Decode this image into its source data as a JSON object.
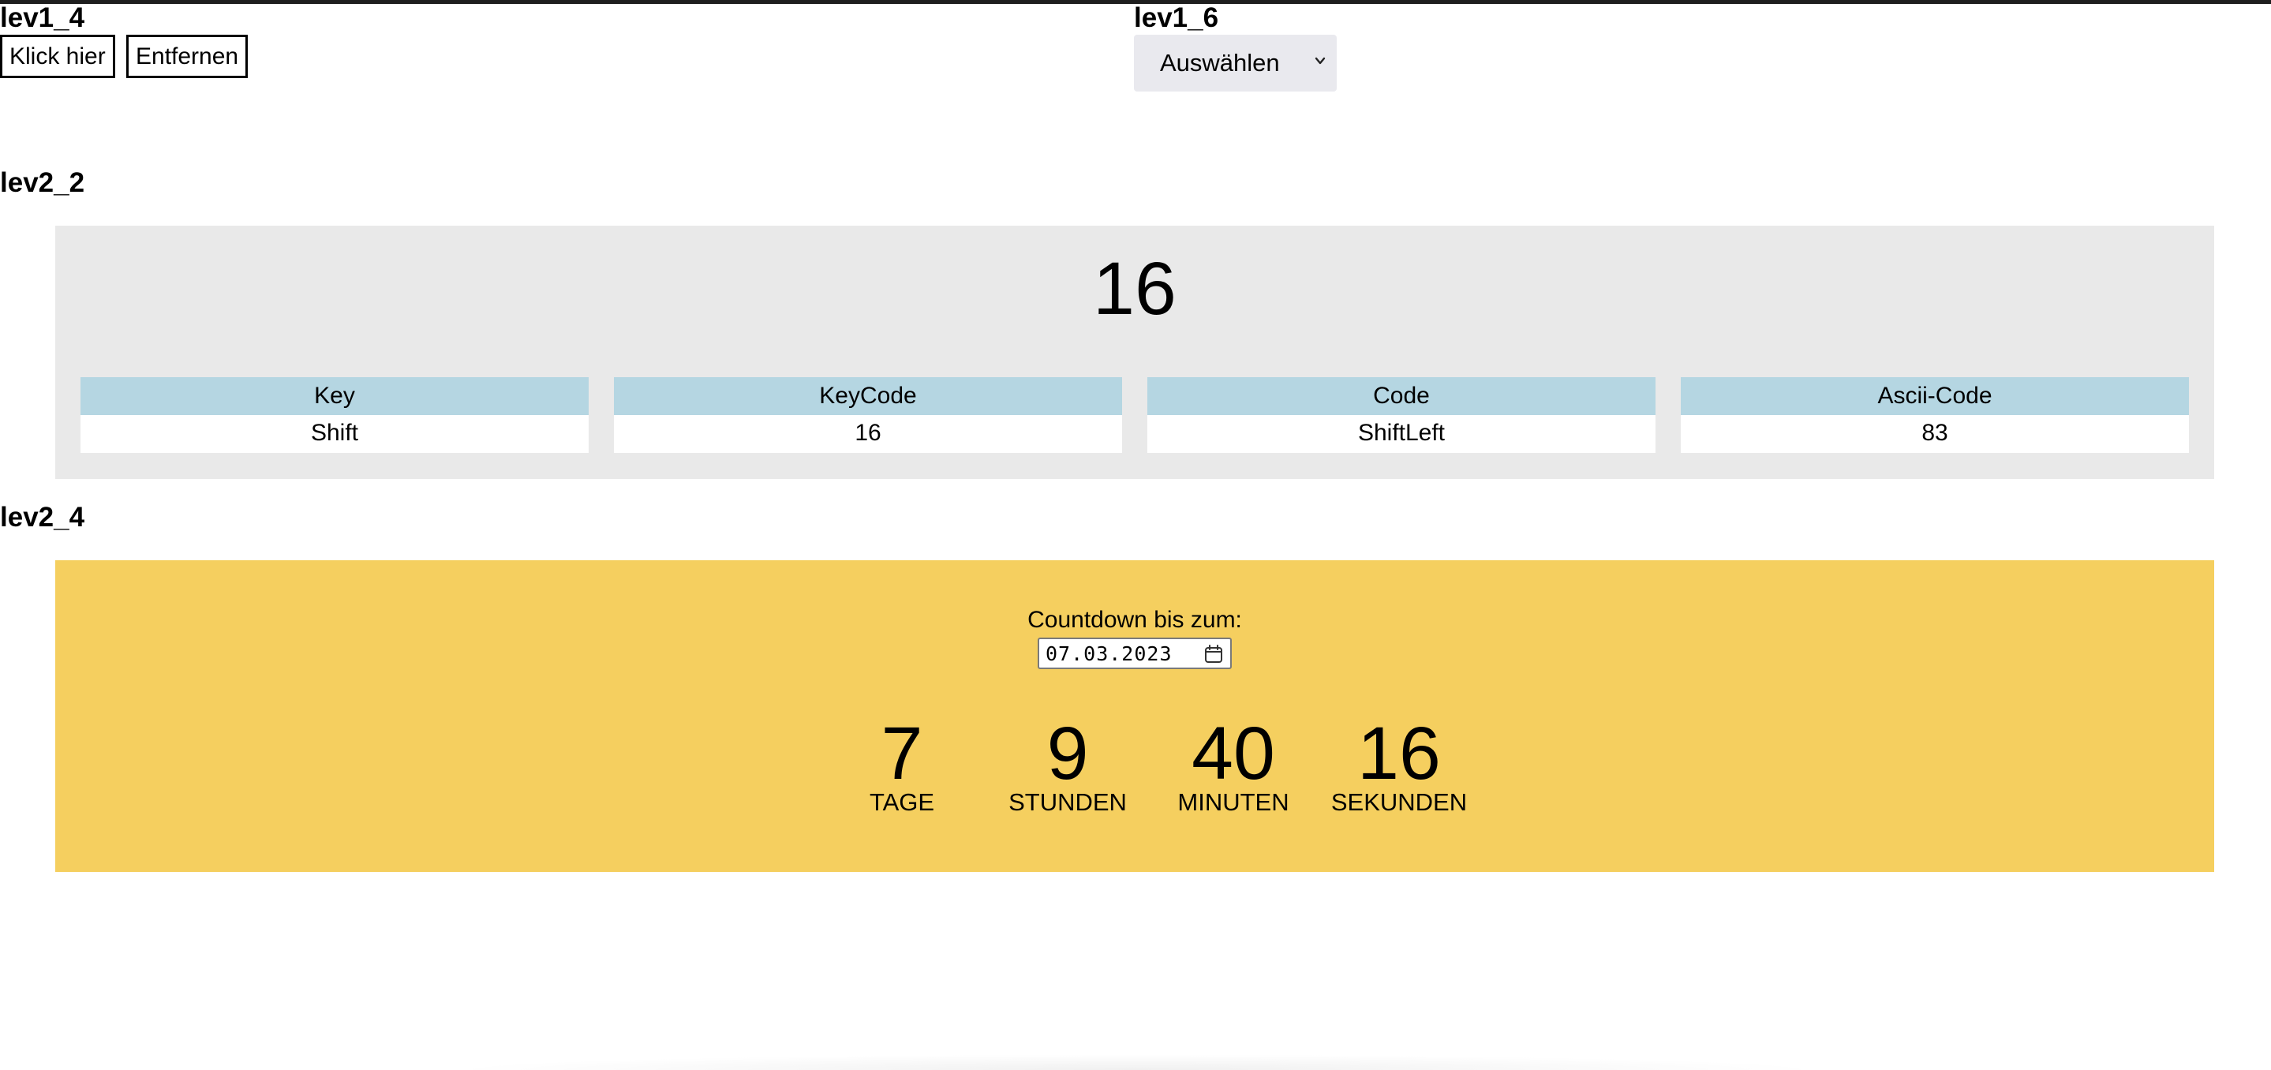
{
  "sections": {
    "lev1_4": {
      "heading": "lev1_4"
    },
    "lev1_6": {
      "heading": "lev1_6"
    },
    "lev2_2": {
      "heading": "lev2_2"
    },
    "lev2_4": {
      "heading": "lev2_4"
    }
  },
  "buttons": {
    "click_label": "Klick hier",
    "remove_label": "Entfernen"
  },
  "select": {
    "selected": "Auswählen",
    "icon": "chevron-down-icon"
  },
  "keypanel": {
    "big_value": "16",
    "accent_color": "#b5d6e2",
    "background": "#e9e9e9",
    "cells": [
      {
        "header": "Key",
        "value": "Shift"
      },
      {
        "header": "KeyCode",
        "value": "16"
      },
      {
        "header": "Code",
        "value": "ShiftLeft"
      },
      {
        "header": "Ascii-Code",
        "value": "83"
      }
    ]
  },
  "countdown": {
    "label": "Countdown bis zum:",
    "date_value": "07.03.2023",
    "date_icon": "calendar-icon",
    "background": "#f5cf5f",
    "units": [
      {
        "value": "7",
        "name": "TAGE"
      },
      {
        "value": "9",
        "name": "STUNDEN"
      },
      {
        "value": "40",
        "name": "MINUTEN"
      },
      {
        "value": "16",
        "name": "SEKUNDEN"
      }
    ]
  }
}
